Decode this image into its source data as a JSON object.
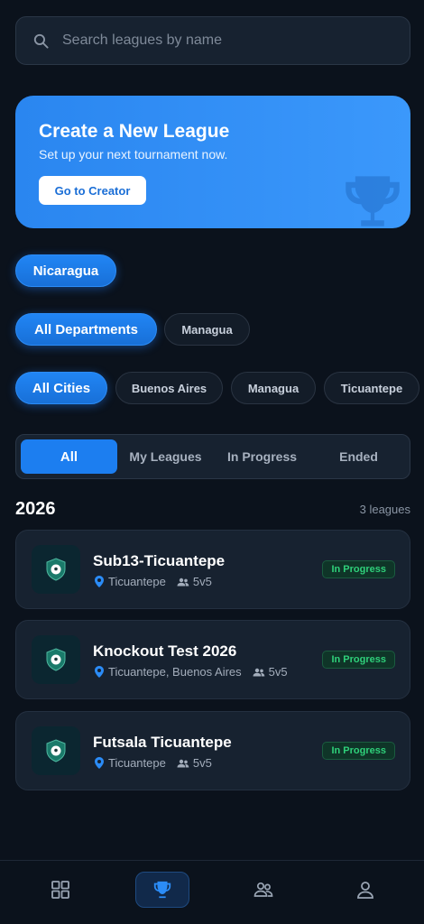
{
  "search": {
    "placeholder": "Search leagues by name"
  },
  "banner": {
    "title": "Create a New League",
    "subtitle": "Set up your next tournament now.",
    "button": "Go to Creator"
  },
  "filters": {
    "countries": [
      {
        "label": "Nicaragua",
        "active": true
      }
    ],
    "departments": [
      {
        "label": "All Departments",
        "active": true
      },
      {
        "label": "Managua",
        "active": false
      }
    ],
    "cities": [
      {
        "label": "All Cities",
        "active": true
      },
      {
        "label": "Buenos Aires",
        "active": false
      },
      {
        "label": "Managua",
        "active": false
      },
      {
        "label": "Ticuantepe",
        "active": false
      }
    ]
  },
  "tabs": [
    {
      "label": "All",
      "active": true
    },
    {
      "label": "My Leagues",
      "active": false
    },
    {
      "label": "In Progress",
      "active": false
    },
    {
      "label": "Ended",
      "active": false
    }
  ],
  "section": {
    "year": "2026",
    "count": "3 leagues"
  },
  "leagues": [
    {
      "name": "Sub13-Ticuantepe",
      "location": "Ticuantepe",
      "format": "5v5",
      "status": "In Progress"
    },
    {
      "name": "Knockout Test 2026",
      "location": "Ticuantepe, Buenos Aires",
      "format": "5v5",
      "status": "In Progress"
    },
    {
      "name": "Futsala Ticuantepe",
      "location": "Ticuantepe",
      "format": "5v5",
      "status": "In Progress"
    }
  ],
  "nav": [
    {
      "icon": "grid-icon",
      "active": false
    },
    {
      "icon": "trophy-icon",
      "active": true
    },
    {
      "icon": "team-icon",
      "active": false
    },
    {
      "icon": "profile-icon",
      "active": false
    }
  ],
  "colors": {
    "accent": "#1c7ef0",
    "background": "#0b121c",
    "card": "#172230",
    "status_green": "#2fd07a"
  }
}
